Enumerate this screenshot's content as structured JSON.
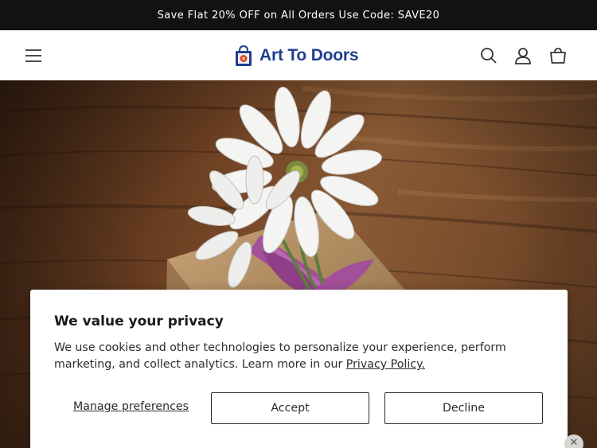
{
  "announcement": {
    "text": "Save Flat 20% OFF on All Orders Use Code: SAVE20"
  },
  "header": {
    "brand": "Art To Doors",
    "icons": [
      "menu-icon",
      "search-icon",
      "account-icon",
      "cart-icon"
    ]
  },
  "hero": {
    "image": "white daisy on kraft gift box with purple ribbon on wooden table"
  },
  "consent": {
    "title": "We value your privacy",
    "body": "We use cookies and other technologies to personalize your experience, perform marketing, and collect analytics. Learn more in our ",
    "policy_link": "Privacy Policy.",
    "manage_label": "Manage preferences",
    "accept_label": "Accept",
    "decline_label": "Decline"
  },
  "colors": {
    "announcement_bg": "#121212",
    "brand_blue": "#1f3f8f",
    "ribbon": "#a3509a"
  }
}
